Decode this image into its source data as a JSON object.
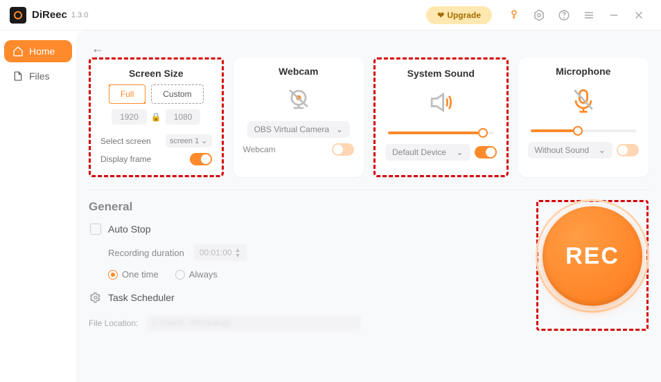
{
  "app": {
    "name": "DiReec",
    "version": "1.3.0"
  },
  "titlebar": {
    "upgrade": "Upgrade"
  },
  "sidebar": {
    "items": [
      {
        "label": "Home"
      },
      {
        "label": "Files"
      }
    ]
  },
  "cards": {
    "screenSize": {
      "title": "Screen Size",
      "full": "Full",
      "custom": "Custom",
      "width": "1920",
      "height": "1080",
      "selectScreenLabel": "Select screen",
      "selectScreenValue": "screen 1",
      "displayFrame": "Display frame"
    },
    "webcam": {
      "title": "Webcam",
      "device": "OBS Virtual Camera",
      "toggleLabel": "Webcam"
    },
    "systemSound": {
      "title": "System Sound",
      "device": "Default Device",
      "level": 90
    },
    "microphone": {
      "title": "Microphone",
      "device": "Without Sound",
      "level": 45
    }
  },
  "general": {
    "title": "General",
    "autoStop": "Auto Stop",
    "recordingDuration": "Recording duration",
    "durationValue": "00:01:00",
    "oneTime": "One time",
    "always": "Always",
    "taskScheduler": "Task Scheduler"
  },
  "rec": {
    "label": "REC"
  },
  "fileLocation": {
    "label": "File Location:"
  }
}
